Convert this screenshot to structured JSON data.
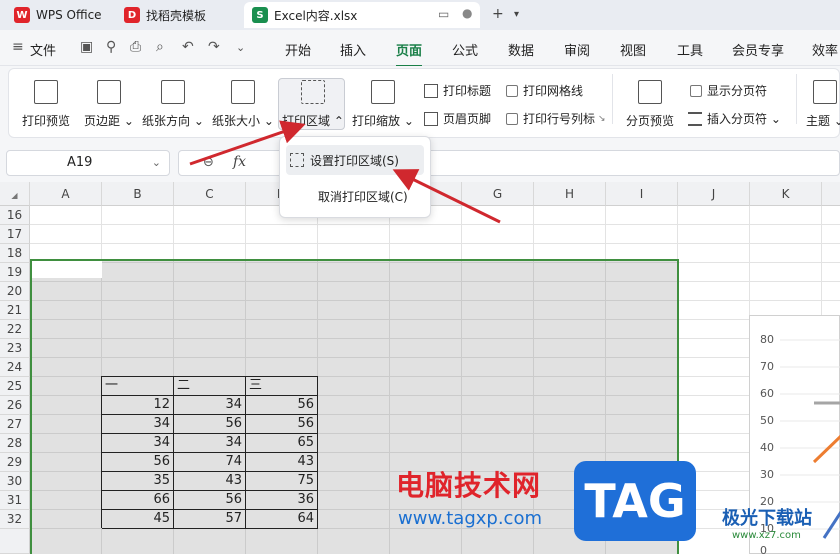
{
  "tabs": [
    {
      "label": "WPS Office",
      "icon": "wps-logo"
    },
    {
      "label": "找稻壳模板",
      "icon": "docer-logo"
    },
    {
      "label": "Excel内容.xlsx",
      "icon": "spreadsheet-logo",
      "icon_letter": "S"
    }
  ],
  "menubar": {
    "file": "文件",
    "items": [
      "开始",
      "插入",
      "页面",
      "公式",
      "数据",
      "审阅",
      "视图",
      "工具",
      "会员专享",
      "效率"
    ],
    "active": "页面"
  },
  "ribbon": {
    "print_preview": "打印预览",
    "margins": "页边距",
    "orientation": "纸张方向",
    "paper_size": "纸张大小",
    "print_area": "打印区域",
    "print_scale": "打印缩放",
    "print_titles": "打印标题",
    "header_footer": "页眉页脚",
    "print_gridlines": "打印网格线",
    "print_row_col": "打印行号列标",
    "page_break_preview": "分页预览",
    "show_page_breaks": "显示分页符",
    "insert_page_break": "插入分页符",
    "theme": "主题"
  },
  "formula_bar": {
    "name_box": "A19",
    "fx": "fx"
  },
  "dropdown": {
    "set_print_area": "设置打印区域(S)",
    "cancel_print_area": "取消打印区域(C)"
  },
  "columns": [
    "A",
    "B",
    "C",
    "D",
    "E",
    "F",
    "G",
    "H",
    "I",
    "J",
    "K"
  ],
  "rows": [
    "16",
    "17",
    "18",
    "19",
    "20",
    "21",
    "22",
    "23",
    "24",
    "25",
    "26",
    "27",
    "28",
    "29",
    "30",
    "31",
    "32"
  ],
  "table": {
    "headers": [
      "一",
      "二",
      "三"
    ],
    "data": [
      [
        12,
        34,
        56
      ],
      [
        34,
        56,
        56
      ],
      [
        34,
        34,
        65
      ],
      [
        56,
        74,
        43
      ],
      [
        35,
        43,
        75
      ],
      [
        66,
        56,
        36
      ],
      [
        45,
        57,
        64
      ]
    ]
  },
  "chart_axis": {
    "ticks": [
      "80",
      "70",
      "60",
      "50",
      "40",
      "30",
      "20",
      "10",
      "0"
    ]
  },
  "watermark": {
    "cn": "电脑技术网",
    "url": "www.tagxp.com",
    "tag": "TAG",
    "site2": "极光下载站",
    "url2": "www.xz7.com"
  },
  "colors": {
    "accent": "#1a7f48",
    "print_area_border": "#3f8f3f",
    "arrow": "#d0282e"
  }
}
